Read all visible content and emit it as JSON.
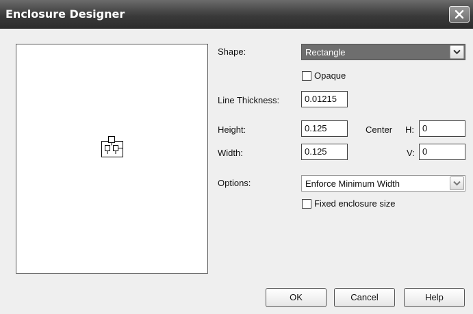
{
  "window": {
    "title": "Enclosure Designer"
  },
  "shape": {
    "label": "Shape:",
    "value": "Rectangle"
  },
  "opaque": {
    "label": "Opaque",
    "checked": false
  },
  "line_thickness": {
    "label": "Line Thickness:",
    "value": "0.01215"
  },
  "height": {
    "label": "Height:",
    "value": "0.125"
  },
  "width": {
    "label": "Width:",
    "value": "0.125"
  },
  "center": {
    "label": "Center",
    "h_label": "H:",
    "h_value": "0",
    "v_label": "V:",
    "v_value": "0"
  },
  "options": {
    "label": "Options:",
    "value": "Enforce Minimum Width"
  },
  "fixed_size": {
    "label": "Fixed enclosure size",
    "checked": false
  },
  "buttons": {
    "ok": "OK",
    "cancel": "Cancel",
    "help": "Help"
  },
  "colors": {
    "selection": "#6e6e6e",
    "titlebar": "#3a3a3a",
    "background": "#efefef"
  },
  "icons": {
    "close": "close-icon",
    "dropdown": "chevron-down-icon",
    "symbol": "component-symbol-icon"
  }
}
